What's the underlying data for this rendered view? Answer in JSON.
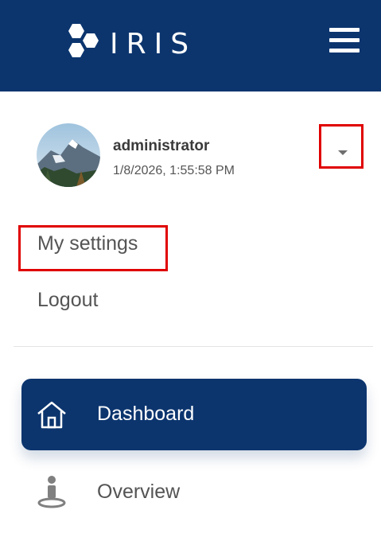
{
  "header": {
    "app_name": "IRIS",
    "brand_color": "#0c356e",
    "menu_icon": "hamburger-menu-icon"
  },
  "user": {
    "name": "administrator",
    "timestamp": "1/8/2026, 1:55:58 PM",
    "avatar_icon": "mountain-avatar-image",
    "dropdown_icon": "caret-down-icon"
  },
  "user_menu": {
    "settings_label": "My settings",
    "logout_label": "Logout"
  },
  "nav": {
    "items": [
      {
        "label": "Dashboard",
        "icon": "home-icon",
        "active": true
      },
      {
        "label": "Overview",
        "icon": "overview-icon",
        "active": false
      }
    ]
  },
  "highlight_color": "#e00000"
}
